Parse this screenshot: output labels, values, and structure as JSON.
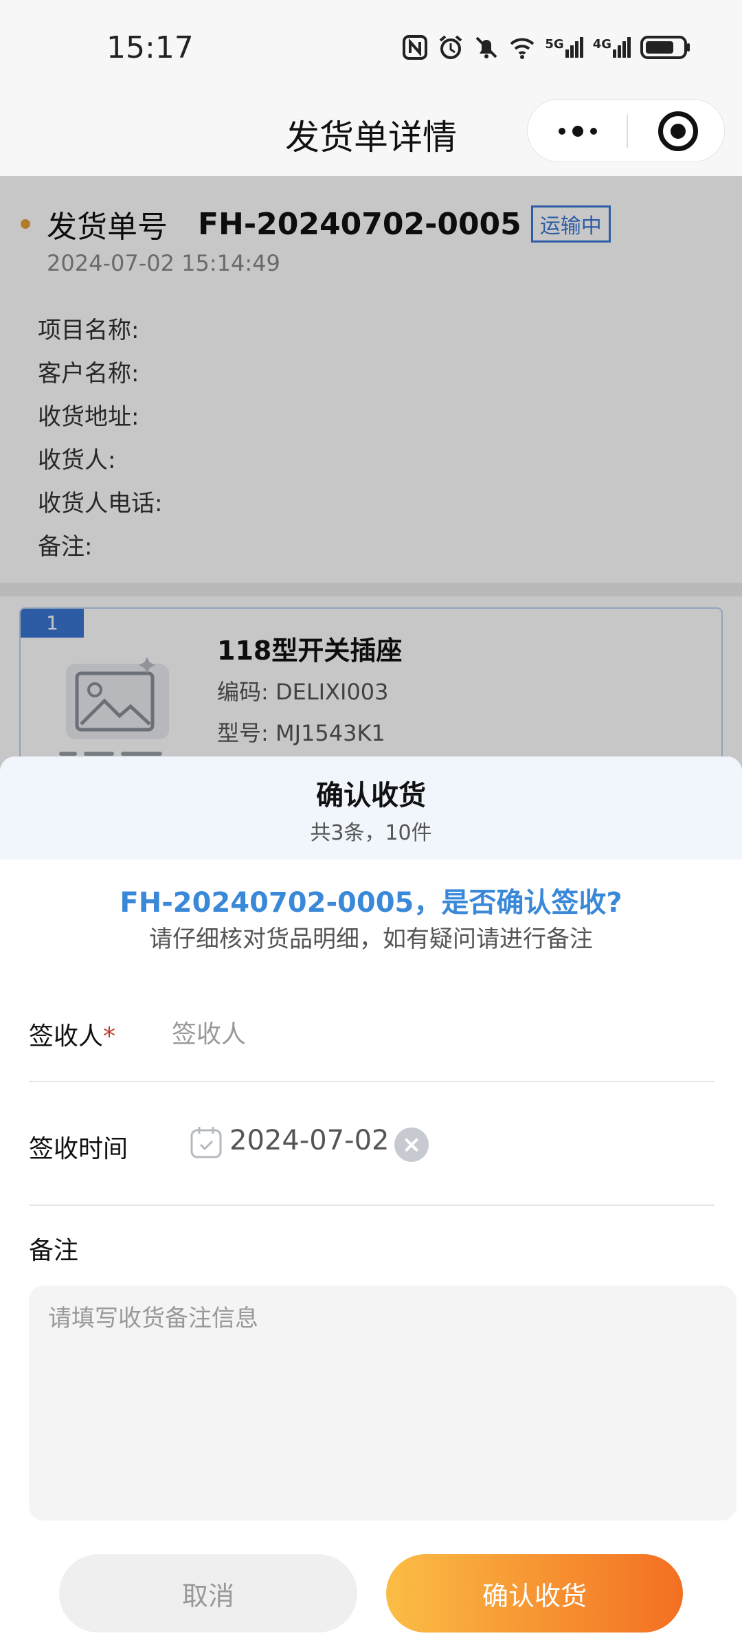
{
  "status_bar": {
    "time": "15:17",
    "signal_5g": "5G",
    "signal_4g": "4G"
  },
  "nav": {
    "title": "发货单详情"
  },
  "order": {
    "label": "发货单号",
    "number": "FH-20240702-0005",
    "status": "运输中",
    "time": "2024-07-02 15:14:49",
    "fields": [
      "项目名称:",
      "客户名称:",
      "收货地址:",
      "收货人:",
      "收货人电话:",
      "备注:"
    ]
  },
  "product": {
    "index": "1",
    "name": "118型开关插座",
    "code": "编码:  DELIXI003",
    "model": "型号:  MJ1543K1"
  },
  "sheet": {
    "title": "确认收货",
    "summary": "共3条，10件",
    "question": "FH-20240702-0005，是否确认签收?",
    "tip": "请仔细核对货品明细，如有疑问请进行备注",
    "signer_label": "签收人",
    "signer_required": "*",
    "signer_placeholder": "签收人",
    "date_label": "签收时间",
    "date_value": "2024-07-02",
    "remark_label": "备注",
    "remark_placeholder": "请填写收货备注信息",
    "cancel_label": "取消",
    "confirm_label": "确认收货"
  },
  "colors": {
    "accent_blue": "#3a88d8",
    "status_blue": "#3a76d4",
    "confirm_start": "#fbbd45",
    "confirm_end": "#f36f22"
  }
}
